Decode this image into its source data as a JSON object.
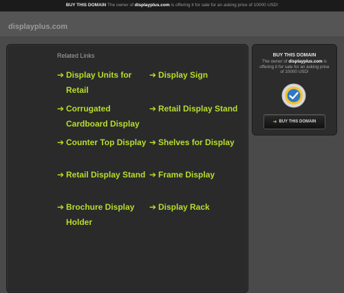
{
  "topbar": {
    "buy_label": "BUY THIS DOMAIN",
    "text_prefix": "The owner of",
    "domain": "displayplus.com",
    "text_suffix": "is offering it for sale for an asking price of 10000 USD!"
  },
  "header": {
    "site_title": "displayplus.com"
  },
  "main": {
    "related_heading": "Related Links",
    "links": [
      "Display Units for Retail",
      "Display Sign",
      "Corrugated Cardboard Display",
      "Retail Display Stand",
      "Counter Top Display",
      "Shelves for Display",
      "Retail Display Stand",
      "Frame Display",
      "Brochure Display Holder",
      "Display Rack"
    ],
    "link_arrow": "➔",
    "link_color": "#b7de2c"
  },
  "sidebar": {
    "title": "BUY THIS DOMAIN",
    "text_prefix": "The owner of",
    "domain": "displayplus.com",
    "text_suffix": "is offering it for sale for an asking price of 10000 USD!",
    "seal_icon": "trust-seal-icon",
    "button_label": "BUY THIS DOMAIN",
    "button_arrow": "➔"
  }
}
